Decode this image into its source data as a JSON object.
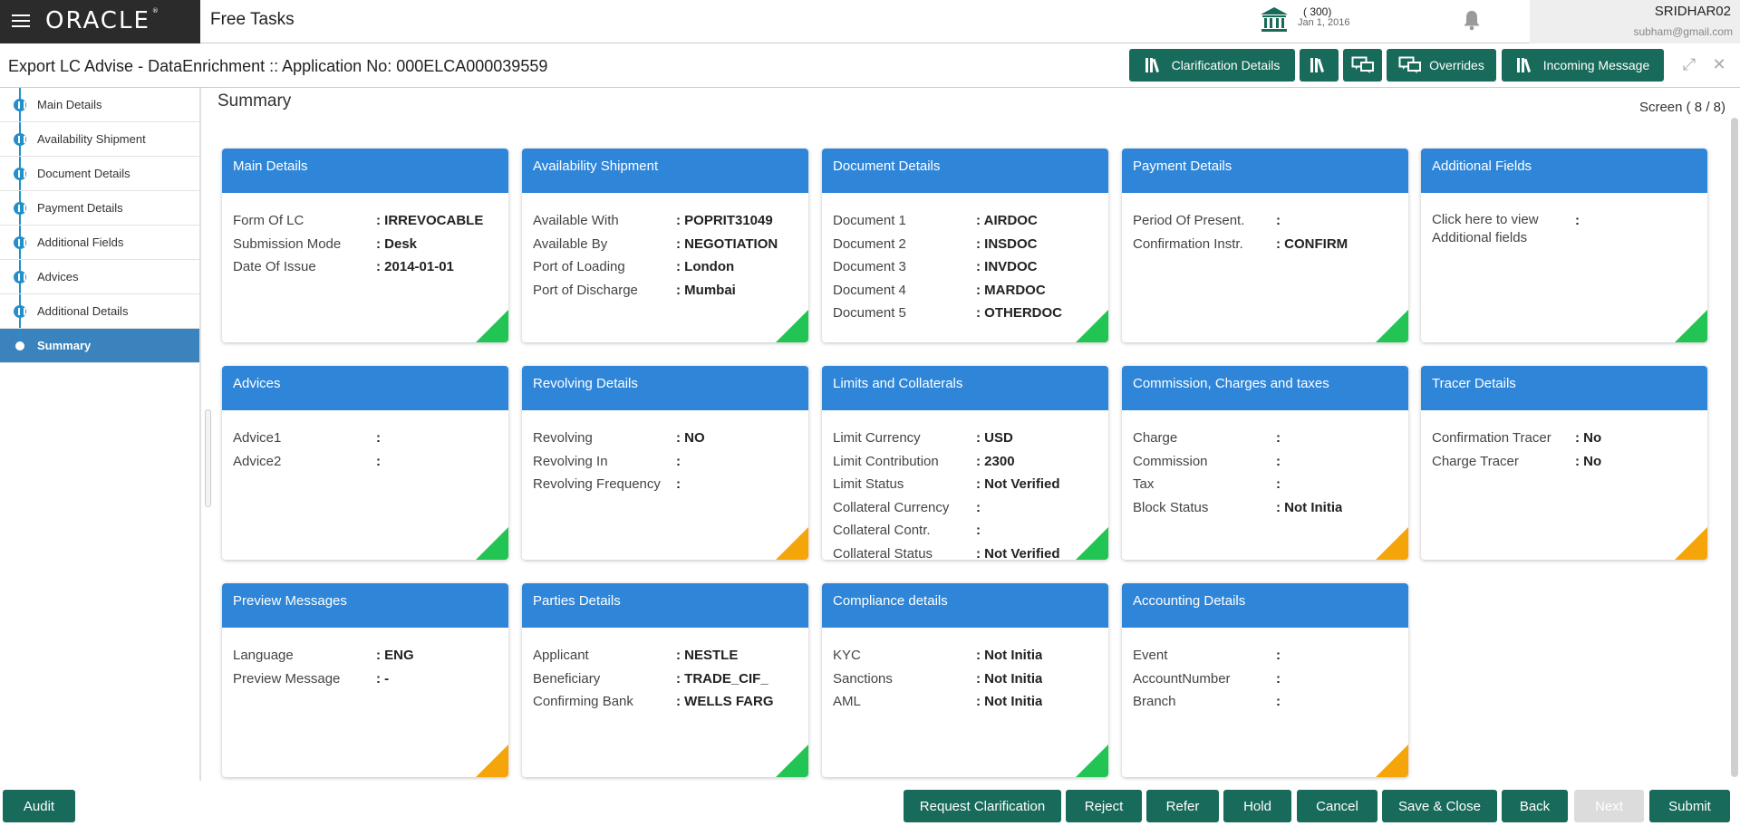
{
  "header": {
    "brand": "ORACLE",
    "app_title": "Free Tasks",
    "count": "( 300)",
    "date": "Jan 1, 2016",
    "user_name": "SRIDHAR02",
    "user_email": "subham@gmail.com"
  },
  "subheader": {
    "title": "Export LC Advise - DataEnrichment :: Application No: 000ELCA000039559",
    "buttons": {
      "clarification": "Clarification Details",
      "overrides": "Overrides",
      "incoming": "Incoming Message"
    }
  },
  "nav": {
    "items": [
      {
        "label": "Main Details"
      },
      {
        "label": "Availability Shipment"
      },
      {
        "label": "Document Details"
      },
      {
        "label": "Payment Details"
      },
      {
        "label": "Additional Fields"
      },
      {
        "label": "Advices"
      },
      {
        "label": "Additional Details"
      },
      {
        "label": "Summary"
      }
    ]
  },
  "main": {
    "title": "Summary",
    "screen": "Screen ( 8 / 8)"
  },
  "cards": {
    "main_details": {
      "title": "Main Details",
      "rows": [
        {
          "k": "Form Of LC",
          "v": ": IRREVOCABLE"
        },
        {
          "k": "Submission Mode",
          "v": ": Desk"
        },
        {
          "k": "Date Of Issue",
          "v": ": 2014-01-01"
        }
      ]
    },
    "availability": {
      "title": "Availability Shipment",
      "rows": [
        {
          "k": "Available With",
          "v": ": POPRIT31049"
        },
        {
          "k": "Available By",
          "v": ": NEGOTIATION"
        },
        {
          "k": "Port of Loading",
          "v": ": London"
        },
        {
          "k": "Port of Discharge",
          "v": ": Mumbai"
        }
      ]
    },
    "document": {
      "title": "Document Details",
      "rows": [
        {
          "k": "Document 1",
          "v": ": AIRDOC"
        },
        {
          "k": "Document 2",
          "v": ": INSDOC"
        },
        {
          "k": "Document 3",
          "v": ": INVDOC"
        },
        {
          "k": "Document 4",
          "v": ": MARDOC"
        },
        {
          "k": "Document 5",
          "v": ": OTHERDOC"
        }
      ]
    },
    "payment": {
      "title": "Payment Details",
      "rows": [
        {
          "k": "Period Of Present.",
          "v": ":"
        },
        {
          "k": "Confirmation Instr.",
          "v": ": CONFIRM"
        }
      ]
    },
    "additional_fields": {
      "title": "Additional Fields",
      "rows": [
        {
          "k": "Click here to view Additional fields",
          "v": ":"
        }
      ]
    },
    "advices": {
      "title": "Advices",
      "rows": [
        {
          "k": "Advice1",
          "v": ":"
        },
        {
          "k": "Advice2",
          "v": ":"
        }
      ]
    },
    "revolving": {
      "title": "Revolving Details",
      "rows": [
        {
          "k": "Revolving",
          "v": ": NO"
        },
        {
          "k": "Revolving In",
          "v": ":"
        },
        {
          "k": "Revolving Frequency",
          "v": ":"
        }
      ]
    },
    "limits": {
      "title": "Limits and Collaterals",
      "rows": [
        {
          "k": "Limit Currency",
          "v": ": USD"
        },
        {
          "k": "Limit Contribution",
          "v": ": 2300"
        },
        {
          "k": "Limit Status",
          "v": ": Not Verified"
        },
        {
          "k": "Collateral Currency",
          "v": ":"
        },
        {
          "k": "Collateral Contr.",
          "v": ":"
        },
        {
          "k": "Collateral Status",
          "v": ": Not Verified"
        }
      ]
    },
    "commission": {
      "title": "Commission, Charges and taxes",
      "rows": [
        {
          "k": "Charge",
          "v": ":"
        },
        {
          "k": "Commission",
          "v": ":"
        },
        {
          "k": "Tax",
          "v": ":"
        },
        {
          "k": "Block Status",
          "v": ": Not Initia"
        }
      ]
    },
    "tracer": {
      "title": "Tracer Details",
      "rows": [
        {
          "k": "Confirmation Tracer",
          "v": ": No"
        },
        {
          "k": "Charge Tracer",
          "v": ": No"
        }
      ]
    },
    "preview": {
      "title": "Preview Messages",
      "rows": [
        {
          "k": "Language",
          "v": ": ENG"
        },
        {
          "k": "Preview Message",
          "v": ": -"
        }
      ]
    },
    "parties": {
      "title": "Parties Details",
      "rows": [
        {
          "k": "Applicant",
          "v": ": NESTLE"
        },
        {
          "k": "Beneficiary",
          "v": ": TRADE_CIF_"
        },
        {
          "k": "Confirming Bank",
          "v": ": WELLS FARG"
        }
      ]
    },
    "compliance": {
      "title": "Compliance details",
      "rows": [
        {
          "k": "KYC",
          "v": ": Not Initia"
        },
        {
          "k": "Sanctions",
          "v": ": Not Initia"
        },
        {
          "k": "AML",
          "v": ": Not Initia"
        }
      ]
    },
    "accounting": {
      "title": "Accounting Details",
      "rows": [
        {
          "k": "Event",
          "v": ":"
        },
        {
          "k": "AccountNumber",
          "v": ":"
        },
        {
          "k": "Branch",
          "v": ":"
        }
      ]
    }
  },
  "footer": {
    "audit": "Audit",
    "request_clarification": "Request Clarification",
    "reject": "Reject",
    "refer": "Refer",
    "hold": "Hold",
    "cancel": "Cancel",
    "save_close": "Save & Close",
    "back": "Back",
    "next": "Next",
    "submit": "Submit"
  },
  "colors": {
    "header_blue": "#2f86d8",
    "action_green": "#186a5a",
    "status_green": "#22c553",
    "status_amber": "#f5a50a",
    "nav_active": "#3b83bd"
  },
  "icons": [
    "hamburger-icon",
    "bank-icon",
    "bell-icon",
    "books-icon",
    "chat-icon",
    "expand-icon",
    "close-icon"
  ]
}
